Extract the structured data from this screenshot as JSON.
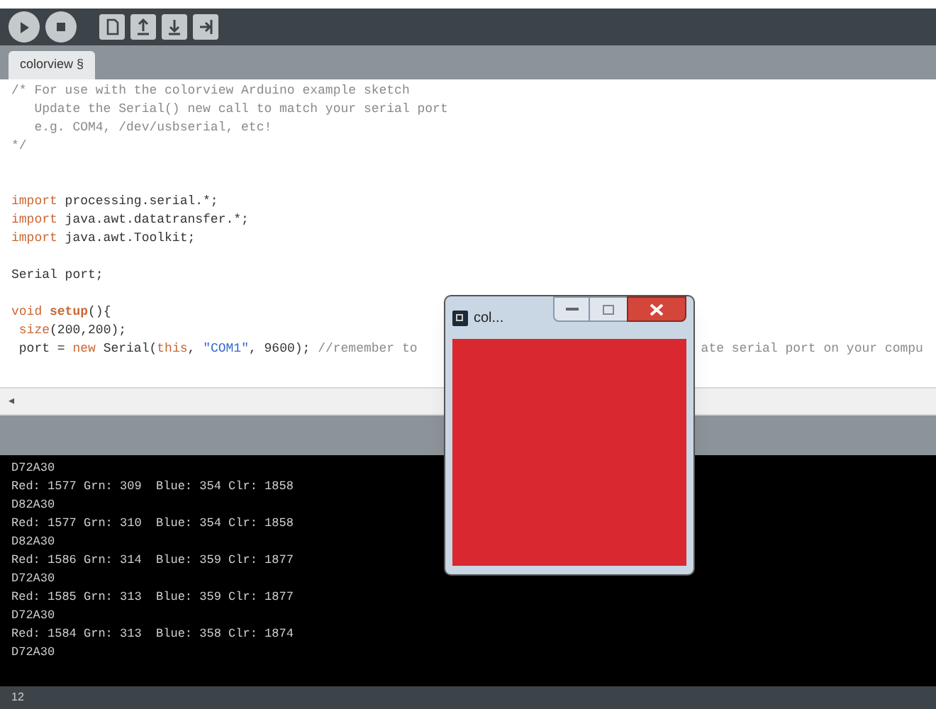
{
  "toolbar": {
    "buttons": [
      {
        "kind": "run"
      },
      {
        "kind": "stop"
      },
      {
        "kind": "new"
      },
      {
        "kind": "open"
      },
      {
        "kind": "save"
      },
      {
        "kind": "export"
      }
    ]
  },
  "tabs": [
    {
      "label": "colorview §",
      "selected": true
    }
  ],
  "editor": {
    "lines": [
      {
        "kind": "code",
        "tokens": [
          {
            "kind": "comment",
            "text": "/* For use with the colorview Arduino example sketch"
          }
        ]
      },
      {
        "kind": "code",
        "tokens": [
          {
            "kind": "comment",
            "text": "   Update the Serial() new call to match your serial port"
          }
        ]
      },
      {
        "kind": "code",
        "tokens": [
          {
            "kind": "comment",
            "text": "   e.g. COM4, /dev/usbserial, etc!"
          }
        ]
      },
      {
        "kind": "code",
        "tokens": [
          {
            "kind": "comment",
            "text": "*/"
          }
        ]
      },
      {
        "kind": "blank"
      },
      {
        "kind": "blank"
      },
      {
        "kind": "code",
        "tokens": [
          {
            "kind": "keyword",
            "text": "import"
          },
          {
            "kind": "plain",
            "text": " processing.serial.*;"
          }
        ]
      },
      {
        "kind": "code",
        "tokens": [
          {
            "kind": "keyword",
            "text": "import"
          },
          {
            "kind": "plain",
            "text": " java.awt.datatransfer.*;"
          }
        ]
      },
      {
        "kind": "code",
        "tokens": [
          {
            "kind": "keyword",
            "text": "import"
          },
          {
            "kind": "plain",
            "text": " java.awt.Toolkit;"
          }
        ]
      },
      {
        "kind": "blank"
      },
      {
        "kind": "code",
        "tokens": [
          {
            "kind": "plain",
            "text": "Serial port;"
          }
        ]
      },
      {
        "kind": "blank"
      },
      {
        "kind": "code",
        "tokens": [
          {
            "kind": "keyword",
            "text": "void"
          },
          {
            "kind": "function",
            "text": " setup"
          },
          {
            "kind": "plain",
            "text": "(){"
          }
        ]
      },
      {
        "kind": "code",
        "tokens": [
          {
            "kind": "builtin",
            "text": " size"
          },
          {
            "kind": "plain",
            "text": "(200,200);"
          }
        ]
      },
      {
        "kind": "code",
        "tokens": [
          {
            "kind": "plain",
            "text": " port = "
          },
          {
            "kind": "keyword",
            "text": "new"
          },
          {
            "kind": "plain",
            "text": " Serial("
          },
          {
            "kind": "keyword",
            "text": "this"
          },
          {
            "kind": "plain",
            "text": ", "
          },
          {
            "kind": "string",
            "text": "\"COM1\""
          },
          {
            "kind": "plain",
            "text": ", 9600); "
          },
          {
            "kind": "comment",
            "text": "//remember to"
          }
        ],
        "covered_tail": {
          "kind": "comment",
          "text": "ate serial port on your compu"
        }
      }
    ]
  },
  "scroll_arrow": "◂",
  "console": {
    "lines": [
      "D72A30",
      "Red: 1577 Grn: 309  Blue: 354 Clr: 1858",
      "D82A30",
      "Red: 1577 Grn: 310  Blue: 354 Clr: 1858",
      "D82A30",
      "Red: 1586 Grn: 314  Blue: 359 Clr: 1877",
      "D72A30",
      "Red: 1585 Grn: 313  Blue: 359 Clr: 1877",
      "D72A30",
      "Red: 1584 Grn: 313  Blue: 358 Clr: 1874",
      "D72A30"
    ]
  },
  "status_bar": {
    "line": "12"
  },
  "sketch_window": {
    "title": "col...",
    "color": "#d9282f"
  }
}
